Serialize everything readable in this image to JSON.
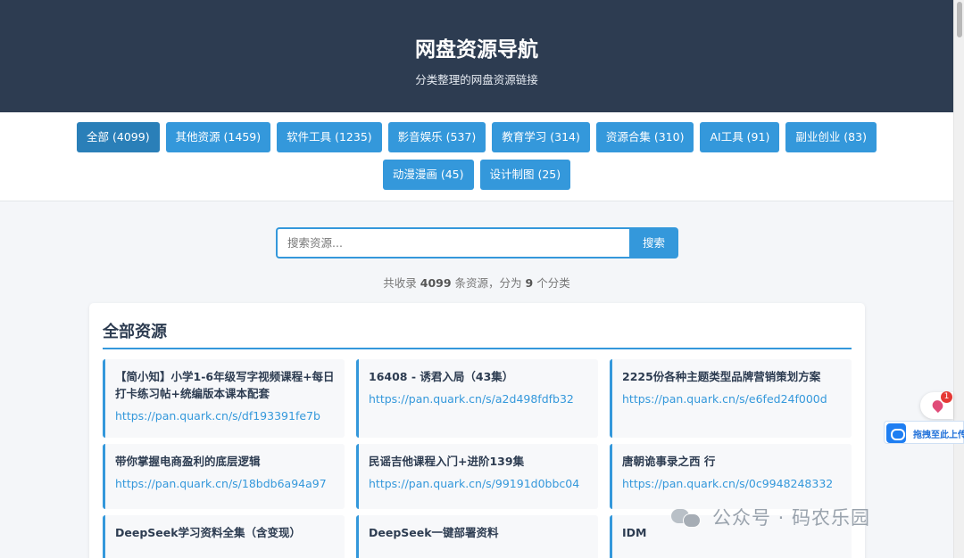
{
  "header": {
    "title": "网盘资源导航",
    "subtitle": "分类整理的网盘资源链接"
  },
  "categories": [
    {
      "label": "全部 (4099)",
      "active": true
    },
    {
      "label": "其他资源 (1459)",
      "active": false
    },
    {
      "label": "软件工具 (1235)",
      "active": false
    },
    {
      "label": "影音娱乐 (537)",
      "active": false
    },
    {
      "label": "教育学习 (314)",
      "active": false
    },
    {
      "label": "资源合集 (310)",
      "active": false
    },
    {
      "label": "AI工具 (91)",
      "active": false
    },
    {
      "label": "副业创业 (83)",
      "active": false
    },
    {
      "label": "动漫漫画 (45)",
      "active": false
    },
    {
      "label": "设计制图 (25)",
      "active": false
    }
  ],
  "search": {
    "placeholder": "搜索资源...",
    "button_label": "搜索"
  },
  "stats": {
    "prefix": "共收录",
    "total": "4099",
    "middle": "条资源，分为",
    "category_count": "9",
    "suffix": "个分类"
  },
  "panel": {
    "title": "全部资源",
    "items": [
      {
        "title": "【简小知】小学1-6年级写字视频课程+每日打卡练习帖+统编版本课本配套",
        "link": "https://pan.quark.cn/s/df193391fe7b"
      },
      {
        "title": "16408 - 诱君入局（43集）",
        "link": "https://pan.quark.cn/s/a2d498fdfb32"
      },
      {
        "title": "2225份各种主题类型品牌营销策划方案",
        "link": "https://pan.quark.cn/s/e6fed24f000d"
      },
      {
        "title": "带你掌握电商盈利的底层逻辑",
        "link": "https://pan.quark.cn/s/18bdb6a94a97"
      },
      {
        "title": "民谣吉他课程入门+进阶139集",
        "link": "https://pan.quark.cn/s/99191d0bbc04"
      },
      {
        "title": "唐朝诡事录之西 行",
        "link": "https://pan.quark.cn/s/0c9948248332"
      },
      {
        "title": "DeepSeek学习资料全集（含变现）",
        "link": ""
      },
      {
        "title": "DeepSeek一键部署资料",
        "link": ""
      },
      {
        "title": "IDM",
        "link": ""
      }
    ]
  },
  "widgets": {
    "badge_count": "1",
    "upload_label": "拖拽至此上传",
    "watermark_text": "公众号 · 码农乐园"
  },
  "colors": {
    "header_bg": "#2d3c51",
    "accent": "#3498db",
    "active_category": "#2a7fb8"
  },
  "icons": [
    "location-pin-icon",
    "cloud-upload-icon",
    "wechat-icon"
  ]
}
